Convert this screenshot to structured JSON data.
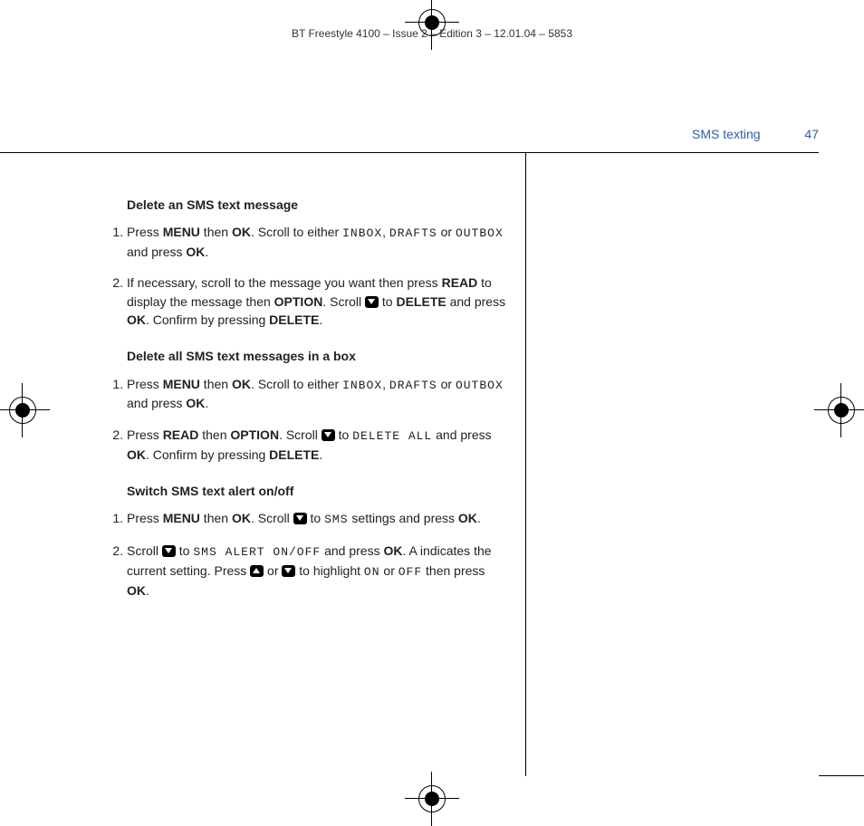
{
  "header": "BT Freestyle 4100 – Issue 2 – Edition 3 – 12.01.04 – 5853",
  "running": {
    "section": "SMS texting",
    "page": "47"
  },
  "sec1": {
    "title": "Delete an SMS text message",
    "s1a": "Press ",
    "s1b": "MENU",
    "s1c": " then ",
    "s1d": "OK",
    "s1e": ". Scroll to either ",
    "s1f": "INBOX",
    "s1g": ", ",
    "s1h": "DRAFTS",
    "s1i": " or ",
    "s1j": "OUTBOX",
    "s1k": " and press ",
    "s1l": "OK",
    "s1m": ".",
    "s2a": "If necessary, scroll to the message you want then press ",
    "s2b": "READ",
    "s2c": " to display the message then ",
    "s2d": "OPTION",
    "s2e": ". Scroll ",
    "s2f": " to ",
    "s2g": "DELETE",
    "s2h": " and press ",
    "s2i": "OK",
    "s2j": ". Confirm by pressing ",
    "s2k": "DELETE",
    "s2l": "."
  },
  "sec2": {
    "title": "Delete all SMS text messages in a box",
    "s1a": "Press ",
    "s1b": "MENU",
    "s1c": " then ",
    "s1d": "OK",
    "s1e": ". Scroll to either ",
    "s1f": "INBOX",
    "s1g": ", ",
    "s1h": "DRAFTS",
    "s1i": " or ",
    "s1j": "OUTBOX",
    "s1k": " and press ",
    "s1l": "OK",
    "s1m": ".",
    "s2a": "Press ",
    "s2b": "READ",
    "s2c": " then ",
    "s2d": "OPTION",
    "s2e": ". Scroll ",
    "s2f": " to ",
    "s2g": "DELETE ALL",
    "s2h": " and press ",
    "s2i": "OK",
    "s2j": ". Confirm by pressing ",
    "s2k": "DELETE",
    "s2l": "."
  },
  "sec3": {
    "title": "Switch SMS text alert on/off",
    "s1a": "Press ",
    "s1b": "MENU",
    "s1c": " then ",
    "s1d": "OK",
    "s1e": ". Scroll ",
    "s1f": " to ",
    "s1g": "SMS",
    "s1h": " settings and press ",
    "s1i": "OK",
    "s1j": ".",
    "s2a": "Scroll ",
    "s2b": " to ",
    "s2c": "SMS ALERT ON/OFF",
    "s2d": " and press ",
    "s2e": "OK",
    "s2f": ". A     indicates the current setting. Press ",
    "s2g": " or ",
    "s2h": " to highlight ",
    "s2i": "ON",
    "s2j": " or ",
    "s2k": "OFF",
    "s2l": " then press ",
    "s2m": "OK",
    "s2n": "."
  }
}
